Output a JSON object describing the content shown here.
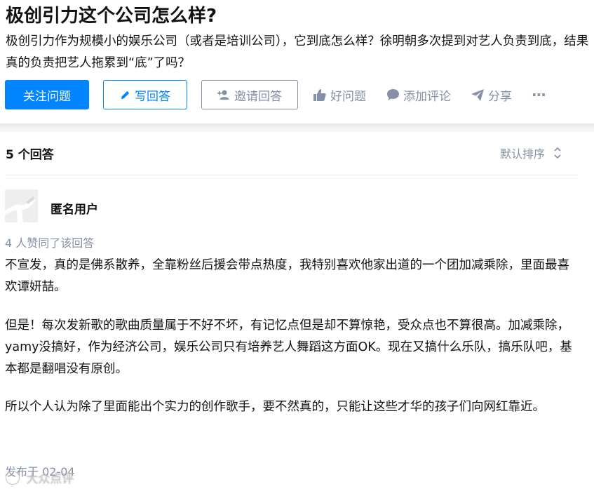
{
  "question": {
    "title": "极创引力这个公司怎么样?",
    "description": "极创引力作为规模小的娱乐公司（或者是培训公司），它到底怎么样？徐明朝多次提到对艺人负责到底，结果真的负责把艺人拖累到“底”了吗？"
  },
  "actions": {
    "follow": "关注问题",
    "write_answer": "写回答",
    "invite": "邀请回答",
    "good_question": "好问题",
    "add_comment": "添加评论",
    "share": "分享",
    "more": "···"
  },
  "answers_header": {
    "count_label": "5 个回答",
    "sort_label": "默认排序"
  },
  "answer": {
    "author": "匿名用户",
    "votes_label": "4 人赞同了该回答",
    "paragraphs": [
      "不宣发，真的是佛系散养，全靠粉丝后援会带点热度，我特别喜欢他家出道的一个团加减乘除，里面最喜欢谭妍喆。",
      "但是！每次发新歌的歌曲质量属于不好不坏，有记忆点但是却不算惊艳，受众点也不算很高。加减乘除，yamy没搞好，作为经济公司，娱乐公司只有培养艺人舞蹈这方面OK。现在又搞什么乐队，搞乐队吧，基本都是翻唱没有原创。",
      "所以个人认为除了里面能出个实力的创作歌手，要不然真的，只能让这些才华的孩子们向网红靠近。"
    ],
    "date": "发布于 02-04"
  },
  "watermark": "大众点评",
  "colors": {
    "primary": "#0084ff",
    "muted": "#8590a6",
    "text": "#121212"
  }
}
